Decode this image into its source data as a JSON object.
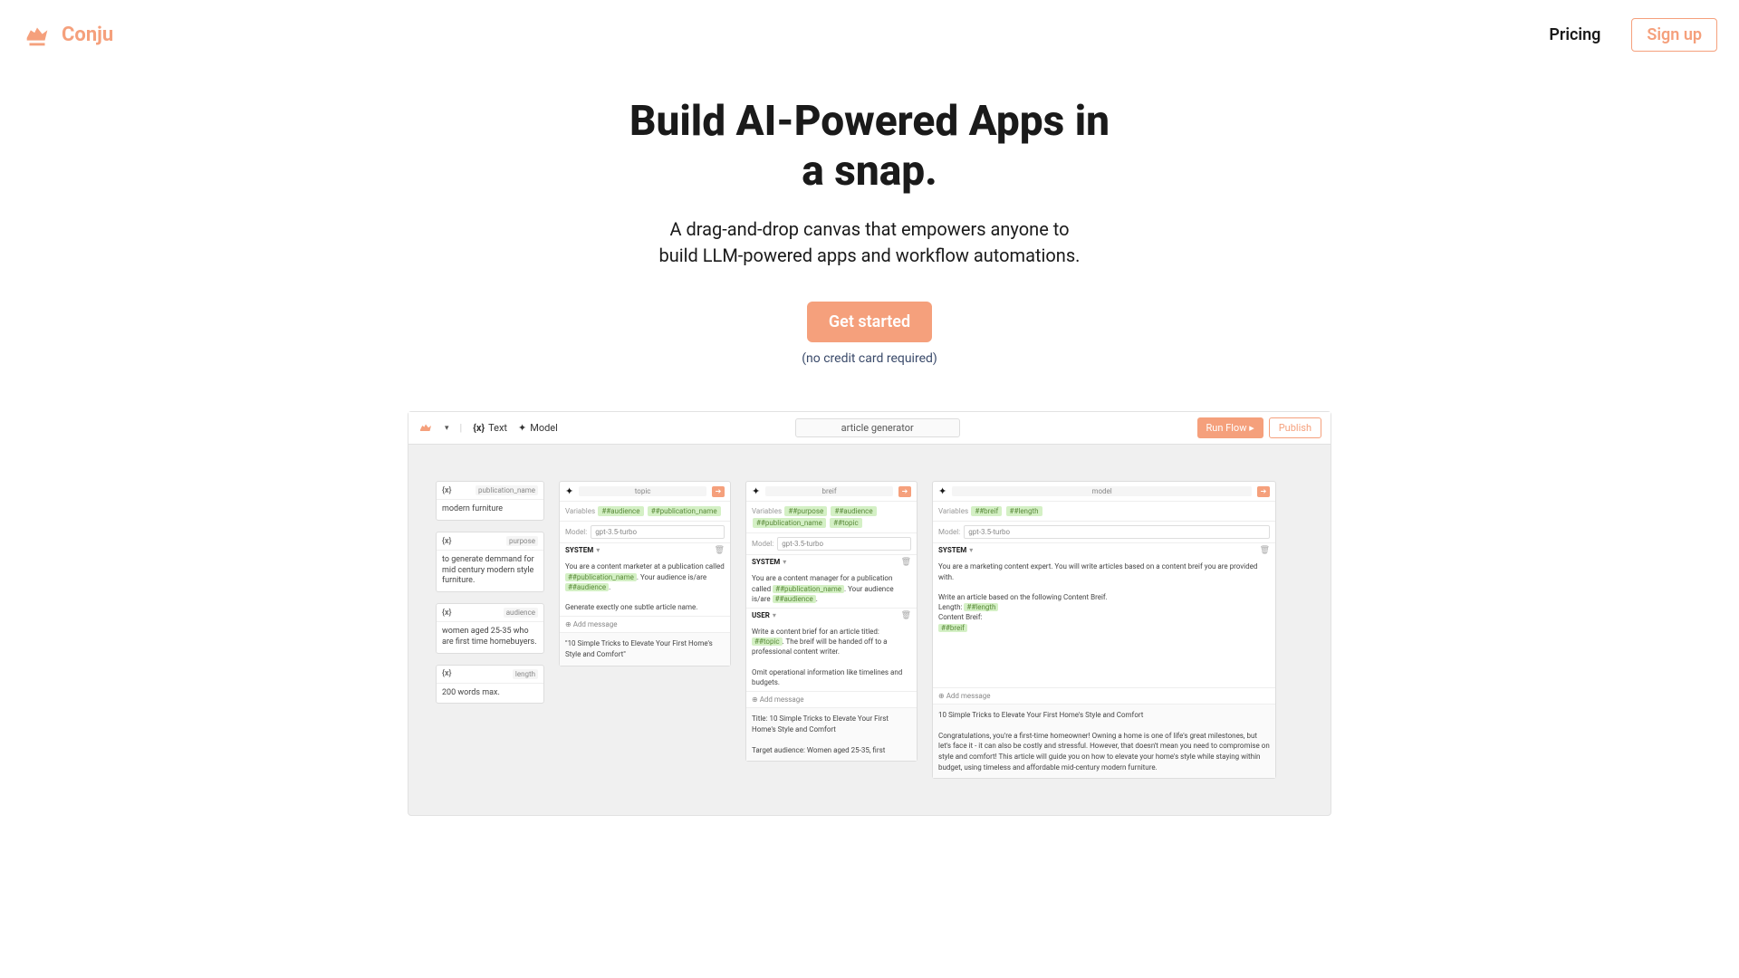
{
  "header": {
    "brand": "Conju",
    "pricing": "Pricing",
    "signup": "Sign up"
  },
  "hero": {
    "title1": "Build AI-Powered Apps in",
    "title2": "a snap.",
    "sub1": "A drag-and-drop canvas that empowers anyone to",
    "sub2": "build LLM-powered apps and workflow automations.",
    "cta": "Get started",
    "note": "(no credit card required)"
  },
  "toolbar": {
    "text": "Text",
    "model": "Model",
    "filename": "article generator",
    "runflow": "Run Flow  ▸",
    "publish": "Publish"
  },
  "vars": {
    "pub_name": {
      "name": "publication_name",
      "value": "modern furniture"
    },
    "purpose": {
      "name": "purpose",
      "value": "to generate demmand for mid century modern style furniture."
    },
    "audience": {
      "name": "audience",
      "value": "women aged 25-35 who are first time homebuyers."
    },
    "length": {
      "name": "length",
      "value": "200 words max."
    }
  },
  "blocks": {
    "topic": {
      "title": "topic",
      "vars_label": "Variables",
      "tags": [
        "##audience",
        "##publication_name"
      ],
      "model_label": "Model:",
      "model": "gpt-3.5-turbo",
      "system_label": "SYSTEM",
      "system_msg_1": "You are a content marketer at a publication called ",
      "system_tag_1": "##publication_name",
      "system_msg_2": ". Your audience is/are ",
      "system_tag_2": "##audience",
      "system_msg_3": ".",
      "system_msg_4": "Generate exectly one subtle article name.",
      "add_msg": "⊕  Add message",
      "output": "\"10 Simple Tricks to Elevate Your First Home's Style and Comfort\""
    },
    "breif": {
      "title": "breif",
      "vars_label": "Variables",
      "tags": [
        "##purpose",
        "##audience",
        "##publication_name",
        "##topic"
      ],
      "model_label": "Model:",
      "model": "gpt-3.5-turbo",
      "system_label": "SYSTEM",
      "system_msg_1": "You are a content manager for a publication called ",
      "system_tag_1": "##publication_name",
      "system_msg_2": ". Your audience is/are ",
      "system_tag_2": "##audience",
      "system_msg_3": ".",
      "user_label": "USER",
      "user_msg_1": "Write a content brief for an article titled: ",
      "user_tag_1": "##topic",
      "user_msg_2": ". The breif will be handed off to a professional content writer.",
      "user_msg_3": "Omit operational information like timelines and budgets.",
      "add_msg": "⊕  Add message",
      "out_1": "Title: 10 Simple Tricks to Elevate Your First Home's Style and Comfort",
      "out_2": "Target audience: Women aged 25-35, first"
    },
    "model": {
      "title": "model",
      "vars_label": "Variables",
      "tags": [
        "##breif",
        "##length"
      ],
      "model_label": "Model:",
      "model": "gpt-3.5-turbo",
      "system_label": "SYSTEM",
      "system_msg_1": "You are a marketing content expert. You will write articles based on a content breif you are provided with.",
      "system_msg_2": "Write an article based on the following Content Breif.",
      "system_msg_3": "Length: ",
      "system_tag_1": "##length",
      "system_msg_4": "Content Breif:",
      "system_tag_2": "##breif",
      "add_msg": "⊕  Add message",
      "out_1": "10 Simple Tricks to Elevate Your First Home's Style and Comfort",
      "out_2": "Congratulations, you're a first-time homeowner! Owning a home is one of life's great milestones, but let's face it - it can also be costly and stressful. However, that doesn't mean you need to compromise on style and comfort! This article will guide you on how to elevate your home's style while staying within budget, using timeless and affordable mid-century modern furniture."
    }
  }
}
